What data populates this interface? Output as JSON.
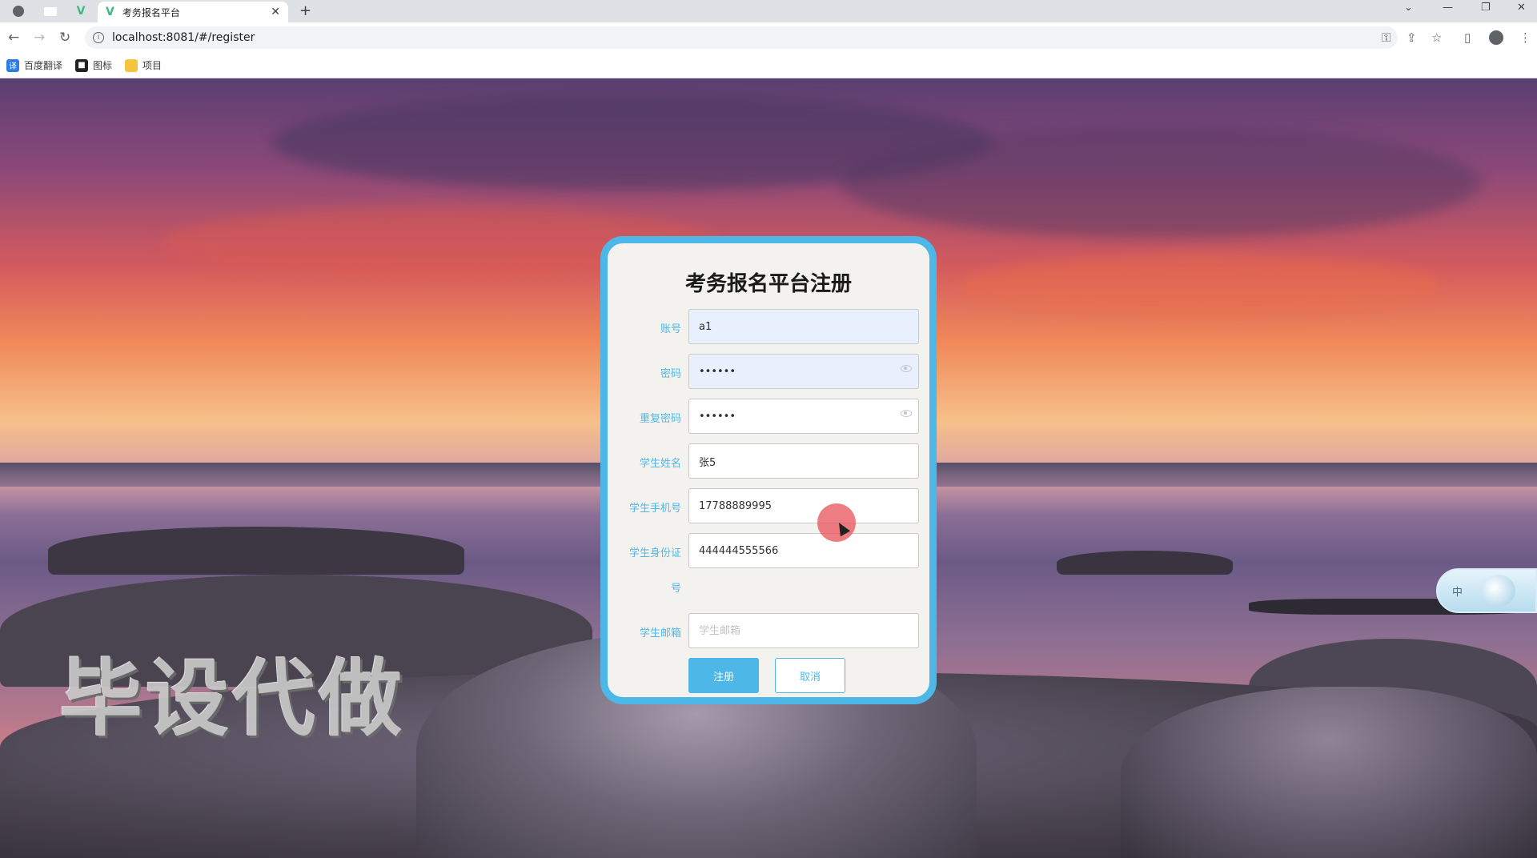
{
  "browser": {
    "tab_title": "考务报名平台",
    "url": "localhost:8081/#/register",
    "bookmarks": [
      {
        "label": "百度翻译",
        "icon": "译"
      },
      {
        "label": "图标",
        "icon": "■"
      },
      {
        "label": "项目",
        "icon": ""
      }
    ]
  },
  "form": {
    "title": "考务报名平台注册",
    "fields": {
      "account": {
        "label": "账号",
        "value": "a1",
        "placeholder": ""
      },
      "password": {
        "label": "密码",
        "value": "••••••",
        "placeholder": ""
      },
      "confirm": {
        "label": "重复密码",
        "value": "••••••",
        "placeholder": ""
      },
      "name": {
        "label": "学生姓名",
        "value": "张5",
        "placeholder": ""
      },
      "phone": {
        "label": "学生手机号",
        "value": "17788889995",
        "placeholder": ""
      },
      "idcard": {
        "label_line1": "学生身份证",
        "label_line2": "号",
        "value": "444444555566",
        "placeholder": ""
      },
      "email": {
        "label": "学生邮箱",
        "value": "",
        "placeholder": "学生邮箱"
      }
    },
    "buttons": {
      "submit": "注册",
      "cancel": "取消"
    }
  },
  "watermark": "毕设代做",
  "ime": {
    "label": "中"
  },
  "colors": {
    "accent": "#4db8e8",
    "card_bg": "#f3f2ee",
    "autofill_bg": "#e8f0fe"
  }
}
